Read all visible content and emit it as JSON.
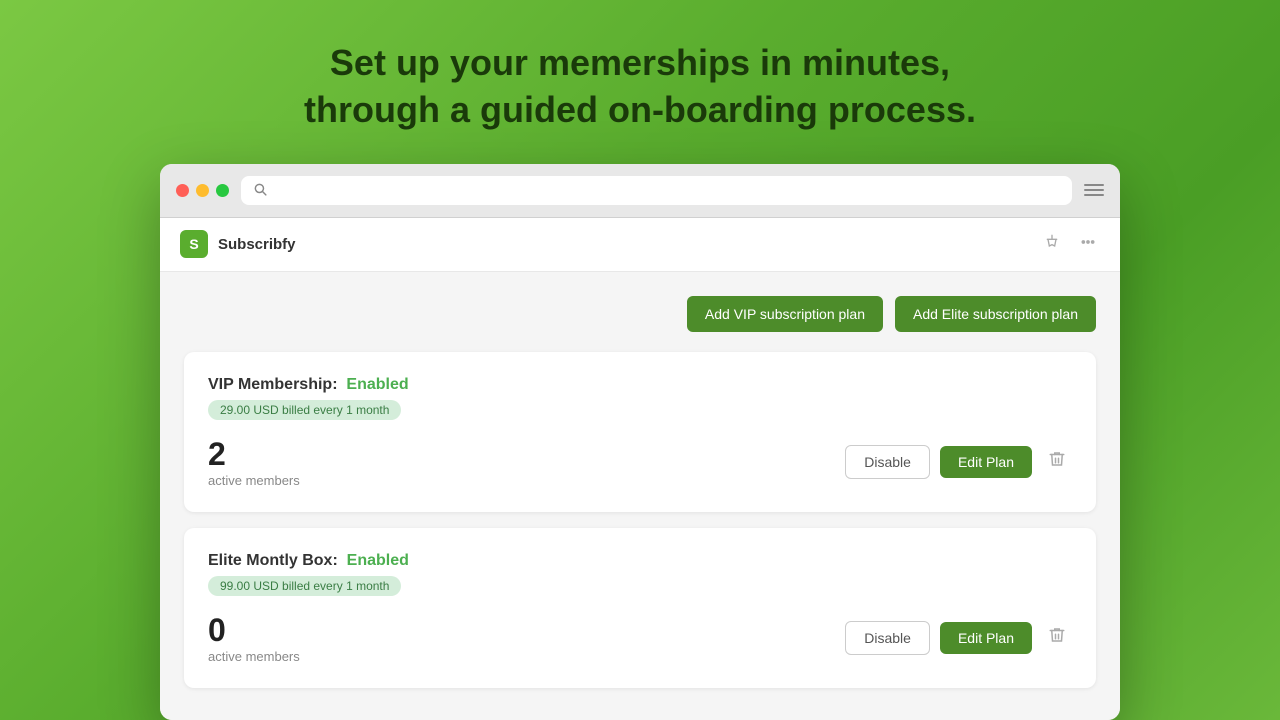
{
  "hero": {
    "line1": "Set up your memerships in minutes,",
    "line2": "through a guided on-boarding process."
  },
  "browser": {
    "hamburger_label": "menu"
  },
  "app": {
    "brand": {
      "icon_letter": "S",
      "name": "Subscribfy"
    },
    "header_actions": {
      "pin_label": "pin",
      "more_label": "more options"
    },
    "action_buttons": {
      "add_vip_label": "Add VIP subscription plan",
      "add_elite_label": "Add Elite subscription plan"
    },
    "plans": [
      {
        "id": "vip",
        "name": "VIP Membership",
        "colon": ":",
        "status": "Enabled",
        "badge": "29.00 USD billed every 1 month",
        "member_count": "2",
        "member_label": "active members",
        "disable_label": "Disable",
        "edit_label": "Edit Plan"
      },
      {
        "id": "elite",
        "name": "Elite Montly Box",
        "colon": ":",
        "status": "Enabled",
        "badge": "99.00 USD billed every 1 month",
        "member_count": "0",
        "member_label": "active members",
        "disable_label": "Disable",
        "edit_label": "Edit Plan"
      }
    ]
  }
}
